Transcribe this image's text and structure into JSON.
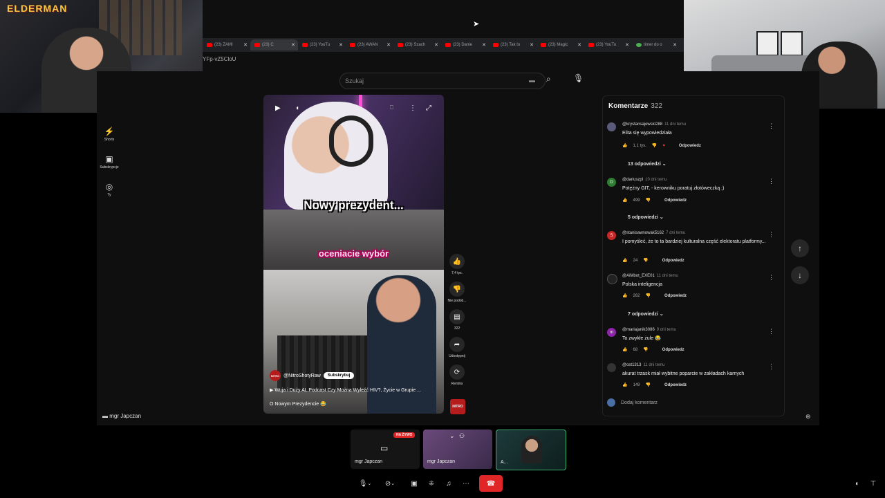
{
  "browser": {
    "tabs": [
      {
        "label": "(23) ZAMI",
        "active": false
      },
      {
        "label": "(23) C",
        "active": true
      },
      {
        "label": "(23) YouTu",
        "active": false
      },
      {
        "label": "(23) AWAN",
        "active": false
      },
      {
        "label": "(23) Szach",
        "active": false
      },
      {
        "label": "(23) Danie",
        "active": false
      },
      {
        "label": "(23) Tak to",
        "active": false
      },
      {
        "label": "(23) Magic",
        "active": false
      },
      {
        "label": "(23) YouTu",
        "active": false
      },
      {
        "label": "timer do o",
        "active": false
      }
    ],
    "url_fragment": "YFp-vZ5CloU"
  },
  "youtube": {
    "search_placeholder": "Szukaj",
    "sidebar": [
      {
        "label": "Shorts",
        "icon": "shorts-icon"
      },
      {
        "label": "Subskrypcje",
        "icon": "subscriptions-icon"
      },
      {
        "label": "Ty",
        "icon": "account-icon"
      }
    ],
    "video": {
      "caption_top": "Nowy prezydent...",
      "caption_mid": "oceniacie wybór",
      "channel": "@NitroShotyRaw",
      "subscribe_label": "Subskrybuj",
      "title": "Wuja i Duży AL Podcast Czy Można Wyleźć HIV?, Życie w Grupie ...",
      "description": "O Nowym Prezydencie 😂"
    },
    "actions": [
      {
        "icon": "thumbs-up-icon",
        "label": "7,4 tys."
      },
      {
        "icon": "thumbs-down-icon",
        "label": "Nie podob..."
      },
      {
        "icon": "comment-icon",
        "label": "322"
      },
      {
        "icon": "share-icon",
        "label": "Udostępnij"
      },
      {
        "icon": "remix-icon",
        "label": "Remiks"
      }
    ],
    "comments": {
      "title": "Komentarze",
      "count": "322",
      "reply_label": "Odpowiedz",
      "add_placeholder": "Dodaj komentarz",
      "items": [
        {
          "user": "@krystansajewski288",
          "time": "11 dni temu",
          "text": "Elita się wypowiedziała",
          "likes": "1,1 tys.",
          "replies": "13 odpowiedzi",
          "avatar_letter": "",
          "avatar_color": "#5a5a7a"
        },
        {
          "user": "@dariuszpl",
          "time": "10 dni temu",
          "text": "Potężny GIT, - kerowniku poratuj złotóweczką ;)",
          "likes": "499",
          "replies": "5 odpowiedzi",
          "avatar_letter": "D",
          "avatar_color": "#2e7d32"
        },
        {
          "user": "@stanisawnowak5162",
          "time": "7 dni temu",
          "text": "I pomyśleć, że to ta bardziej kulturalna część elektoratu platformy...",
          "likes": "24",
          "replies": "",
          "avatar_letter": "S",
          "avatar_color": "#c62828"
        },
        {
          "user": "@AiMbot_EXE01",
          "time": "11 dni temu",
          "text": "Polska inteligencja",
          "likes": "262",
          "replies": "7 odpowiedzi",
          "avatar_letter": "",
          "avatar_color": "#222222"
        },
        {
          "user": "@mariajanik3086",
          "time": "9 dni temu",
          "text": "To zwykłe żule 😂",
          "likes": "68",
          "replies": "",
          "avatar_letter": "m",
          "avatar_color": "#8e24aa"
        },
        {
          "user": "@ost1313",
          "time": "11 dni temu",
          "text": "akurat trzask miał wybitne poparcie w zakładach karnych",
          "likes": "149",
          "replies": "",
          "avatar_letter": "",
          "avatar_color": "#333333"
        }
      ]
    }
  },
  "call": {
    "presenter_label": "mgr Japczan",
    "live_badge": "NA ŻYWO",
    "tiles": [
      {
        "label": "mgr Japczan"
      },
      {
        "label": "mgr Japczan"
      },
      {
        "label": "A..."
      }
    ]
  },
  "stream": {
    "logo_text": "ELDERMAN"
  }
}
